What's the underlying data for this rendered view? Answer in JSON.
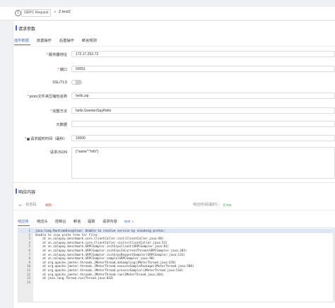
{
  "topbar": {
    "badge": "1",
    "method": "GRPC Request",
    "dropdown_arrow": "∨",
    "name": "Z.test2"
  },
  "request": {
    "section_title": "请求参数",
    "tabs": [
      "插件数据",
      "前置操作",
      "后置操作",
      "断言规则"
    ],
    "active_tab_index": 0,
    "fields": {
      "server_address": {
        "label": "服务器地址",
        "required": true,
        "value": "172.17.253.73"
      },
      "port": {
        "label": "端口",
        "required": true,
        "value": "50051"
      },
      "ssl_tls": {
        "label": "SSL/TLS",
        "required": false,
        "enabled": false
      },
      "proto_zip": {
        "label": "proto文件夹压缩包名称",
        "required": true,
        "value": "hello.zip"
      },
      "full_method": {
        "label": "完整方法",
        "required": true,
        "value": "hello.Greeter/SayHello"
      },
      "metadata": {
        "label": "元数据",
        "required": false,
        "value": ""
      },
      "deadline": {
        "label": "请求超时时间（毫秒）",
        "required": true,
        "value": "10000"
      },
      "request_json": {
        "label": "请求JSON",
        "required": false,
        "value": "{\"name\":\"hihi\"}"
      }
    },
    "info_icon": "info-circle-icon"
  },
  "response": {
    "section_title": "响应内容",
    "collapse_icon": "chevron-down-icon",
    "status_label": "状态码",
    "status_value": "400",
    "status_color": "#e0301e",
    "time_label": "响应时间(毫秒)：",
    "time_value": "0 ms",
    "time_color": "#2eae4b",
    "tabs": [
      "响应体",
      "响应头",
      "控制台",
      "断言",
      "提取",
      "请求内容"
    ],
    "format_select": "text",
    "format_arrow": "∨",
    "active_tab_index": 0,
    "code_lines": [
      "java.lang.RuntimeException: Unable to resolve service by invoking protoc:",
      "Unable to scan proto tree for files",
      "    at vn.zalopay.benchmark.core.ClientCaller.init(ClientCaller.java:88)",
      "    at vn.zalopay.benchmark.core.ClientCaller.<init>(ClientCaller.java:53)",
      "    at vn.zalopay.benchmark.GRPCSampler.initGrpcClient(GRPCSampler.java:81)",
      "    at vn.zalopay.benchmark.GRPCSampler.initGrpcInCurrentThread(GRPCSampler.java:203)",
      "    at vn.zalopay.benchmark.GRPCSampler.initGrpcRequestSampler(GRPCSampler.java:133)",
      "    at vn.zalopay.benchmark.GRPCSampler.sample(GRPCSampler.java:98)",
      "    at org.apache.jmeter.threads.JMeterThread.doSampling(JMeterThread.java:670)",
      "    at org.apache.jmeter.threads.JMeterThread.executeSamplePackage(JMeterThread.java:588)",
      "    at org.apache.jmeter.threads.JMeterThread.processSampler(JMeterThread.java:510)",
      "    at org.apache.jmeter.threads.JMeterThread.run(JMeterThread.java:264)",
      "    at java.lang.Thread.run(Thread.java:833)",
      ""
    ]
  },
  "colors": {
    "accent": "#3f6ad8",
    "section_bar": "#4a69c4",
    "required": "#e33333"
  }
}
